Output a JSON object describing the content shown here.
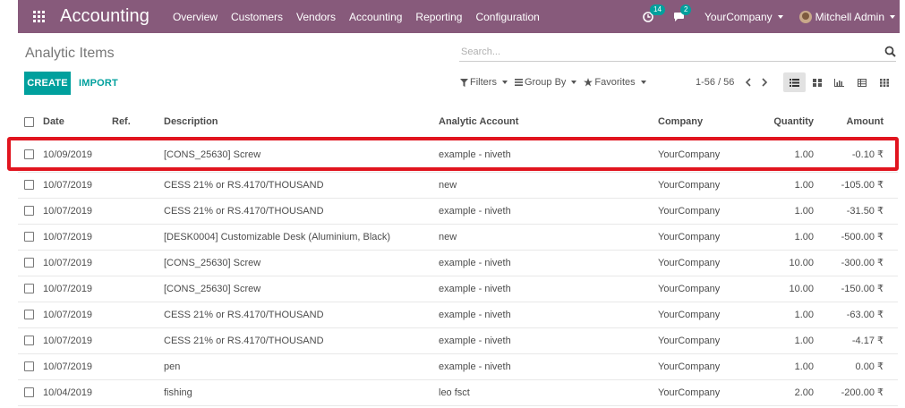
{
  "navbar": {
    "app_title": "Accounting",
    "menu": [
      "Overview",
      "Customers",
      "Vendors",
      "Accounting",
      "Reporting",
      "Configuration"
    ],
    "activity_count": "14",
    "message_count": "2",
    "company": "YourCompany",
    "user": "Mitchell Admin"
  },
  "breadcrumb": "Analytic Items",
  "search": {
    "placeholder": "Search..."
  },
  "buttons": {
    "create": "CREATE",
    "import": "IMPORT"
  },
  "search_options": {
    "filters": "Filters",
    "group_by": "Group By",
    "favorites": "Favorites"
  },
  "pager": {
    "value": "1-56 / 56"
  },
  "table": {
    "columns": [
      "Date",
      "Ref.",
      "Description",
      "Analytic Account",
      "Company",
      "Quantity",
      "Amount"
    ],
    "currency_symbol": "₹",
    "rows": [
      {
        "date": "10/09/2019",
        "ref": "",
        "description": "[CONS_25630] Screw",
        "account": "example - niveth",
        "company": "YourCompany",
        "quantity": "1.00",
        "amount": "-0.10"
      },
      {
        "date": "10/07/2019",
        "ref": "",
        "description": "CESS 21% or RS.4170/THOUSAND",
        "account": "new",
        "company": "YourCompany",
        "quantity": "1.00",
        "amount": "-105.00"
      },
      {
        "date": "10/07/2019",
        "ref": "",
        "description": "CESS 21% or RS.4170/THOUSAND",
        "account": "example - niveth",
        "company": "YourCompany",
        "quantity": "1.00",
        "amount": "-31.50"
      },
      {
        "date": "10/07/2019",
        "ref": "",
        "description": "[DESK0004] Customizable Desk (Aluminium, Black)",
        "account": "new",
        "company": "YourCompany",
        "quantity": "1.00",
        "amount": "-500.00"
      },
      {
        "date": "10/07/2019",
        "ref": "",
        "description": "[CONS_25630] Screw",
        "account": "example - niveth",
        "company": "YourCompany",
        "quantity": "10.00",
        "amount": "-300.00"
      },
      {
        "date": "10/07/2019",
        "ref": "",
        "description": "[CONS_25630] Screw",
        "account": "example - niveth",
        "company": "YourCompany",
        "quantity": "10.00",
        "amount": "-150.00"
      },
      {
        "date": "10/07/2019",
        "ref": "",
        "description": "CESS 21% or RS.4170/THOUSAND",
        "account": "example - niveth",
        "company": "YourCompany",
        "quantity": "1.00",
        "amount": "-63.00"
      },
      {
        "date": "10/07/2019",
        "ref": "",
        "description": "CESS 21% or RS.4170/THOUSAND",
        "account": "example - niveth",
        "company": "YourCompany",
        "quantity": "1.00",
        "amount": "-4.17"
      },
      {
        "date": "10/07/2019",
        "ref": "",
        "description": "pen",
        "account": "example - niveth",
        "company": "YourCompany",
        "quantity": "1.00",
        "amount": "0.00"
      },
      {
        "date": "10/04/2019",
        "ref": "",
        "description": "fishing",
        "account": "leo fsct",
        "company": "YourCompany",
        "quantity": "2.00",
        "amount": "-200.00"
      }
    ]
  },
  "colors": {
    "navbar": "#875a7b",
    "primary": "#00a09d",
    "highlight": "#e1141e"
  }
}
